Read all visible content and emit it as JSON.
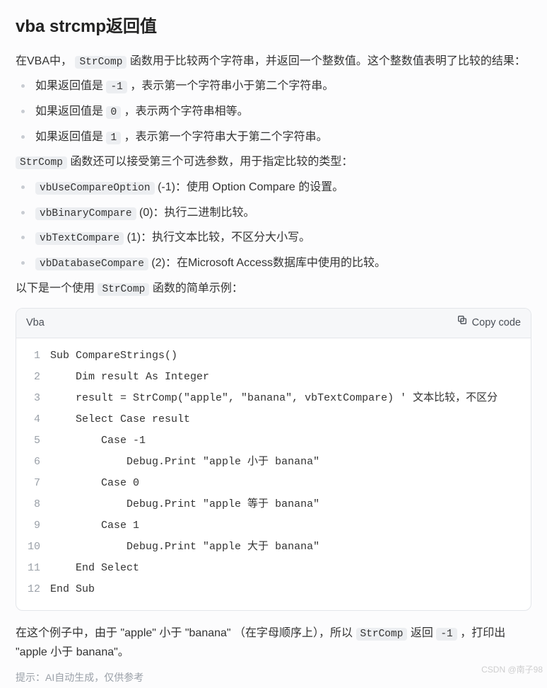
{
  "title": "vba strcmp返回值",
  "intro_pre": "在VBA中，",
  "intro_code": "StrComp",
  "intro_post": " 函数用于比较两个字符串，并返回一个整数值。这个整数值表明了比较的结果：",
  "ret_items": [
    {
      "pre": "如果返回值是 ",
      "code": "-1",
      "post": " ，表示第一个字符串小于第二个字符串。"
    },
    {
      "pre": "如果返回值是 ",
      "code": "0",
      "post": " ，表示两个字符串相等。"
    },
    {
      "pre": "如果返回值是 ",
      "code": "1",
      "post": " ，表示第一个字符串大于第二个字符串。"
    }
  ],
  "param_pre_code": "StrComp",
  "param_pre_text": " 函数还可以接受第三个可选参数，用于指定比较的类型：",
  "param_items": [
    {
      "code": "vbUseCompareOption",
      "text": " (-1)：使用 Option Compare 的设置。"
    },
    {
      "code": "vbBinaryCompare",
      "text": " (0)：执行二进制比较。"
    },
    {
      "code": "vbTextCompare",
      "text": " (1)：执行文本比较，不区分大小写。"
    },
    {
      "code": "vbDatabaseCompare",
      "text": " (2)：在Microsoft Access数据库中使用的比较。"
    }
  ],
  "example_pre": "以下是一个使用 ",
  "example_code": "StrComp",
  "example_post": " 函数的简单示例：",
  "code": {
    "lang": "Vba",
    "copy_label": "Copy code",
    "lines": [
      "Sub CompareStrings()",
      "    Dim result As Integer",
      "    result = StrComp(\"apple\", \"banana\", vbTextCompare) ' 文本比较，不区分",
      "    Select Case result",
      "        Case -1",
      "            Debug.Print \"apple 小于 banana\"",
      "        Case 0",
      "            Debug.Print \"apple 等于 banana\"",
      "        Case 1",
      "            Debug.Print \"apple 大于 banana\"",
      "    End Select",
      "End Sub"
    ]
  },
  "outro": {
    "p1": "在这个例子中，由于 \"apple\" 小于 \"banana\" （在字母顺序上），所以 ",
    "c1": "StrComp",
    "p2": " 返回 ",
    "c2": "-1",
    "p3": " ，打印出 \"apple 小于 banana\"。"
  },
  "hint": "提示：AI自动生成，仅供参考",
  "watermark": "CSDN @南子98"
}
